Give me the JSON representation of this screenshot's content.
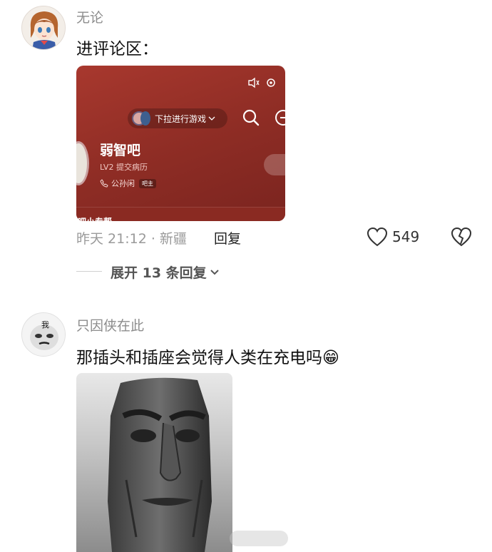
{
  "comments": [
    {
      "username": "无论",
      "text": "进评论区：",
      "avatar": "anime-girl-avatar",
      "meta": "昨天 21:12 · 新疆",
      "reply_label": "回复",
      "likes": "549",
      "expand_label": "展开 13 条回复",
      "embedded": {
        "pill_label": "下拉进行游戏",
        "forum_name": "弱智吧",
        "level": "LV2 提交病历",
        "owner_name": "公孙闲",
        "owner_tag": "吧主",
        "bottom_text": "吧小专帮"
      }
    },
    {
      "username": "只因侠在此",
      "text": "那插头和插座会觉得人类在充电吗",
      "emoji": "😁",
      "avatar": "meme-face-avatar",
      "image": "moai-statue-photo"
    }
  ],
  "colors": {
    "embed_bg": "#9a3028",
    "meta_text": "#9a9a9a",
    "username_text": "#8c8c8c"
  }
}
